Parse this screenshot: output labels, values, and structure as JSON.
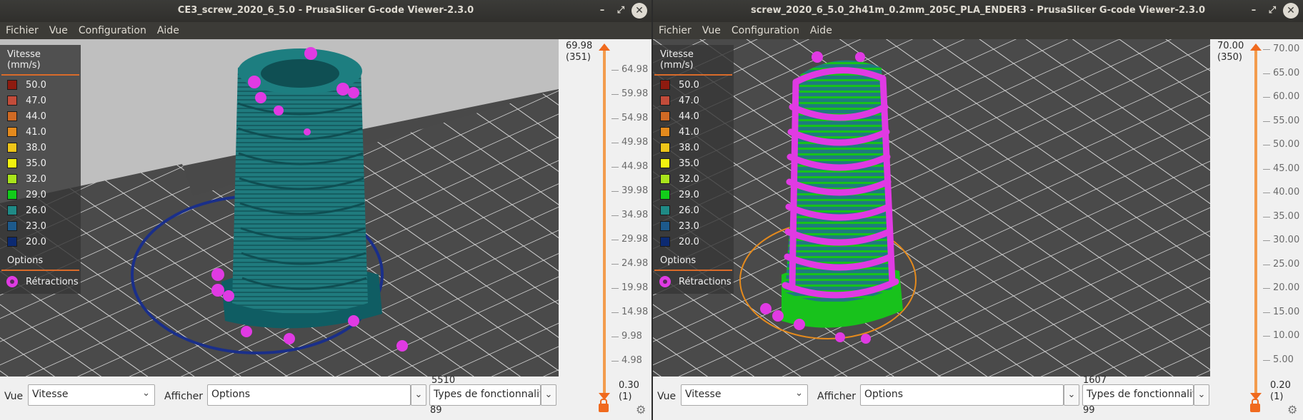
{
  "left": {
    "title": "CE3_screw_2020_6_5.0 - PrusaSlicer G-code Viewer-2.3.0",
    "menu": [
      "Fichier",
      "Vue",
      "Configuration",
      "Aide"
    ],
    "legend": {
      "title": "Vitesse (mm/s)",
      "items": [
        {
          "label": "50.0",
          "color": "#8e1b10"
        },
        {
          "label": "47.0",
          "color": "#c24c3a"
        },
        {
          "label": "44.0",
          "color": "#d06a24"
        },
        {
          "label": "41.0",
          "color": "#e48a1d"
        },
        {
          "label": "38.0",
          "color": "#eec519"
        },
        {
          "label": "35.0",
          "color": "#f2f20f"
        },
        {
          "label": "32.0",
          "color": "#a9e41c"
        },
        {
          "label": "29.0",
          "color": "#12cc1a"
        },
        {
          "label": "26.0",
          "color": "#1f8a86"
        },
        {
          "label": "23.0",
          "color": "#1d5a8c"
        },
        {
          "label": "20.0",
          "color": "#0c2a72"
        }
      ],
      "options_title": "Options",
      "retractions": "Rétractions"
    },
    "slider": {
      "top_value": "69.98",
      "top_layer": "(351)",
      "bottom_value": "0.30",
      "bottom_layer": "(1)",
      "ticks": [
        "64.98",
        "59.98",
        "54.98",
        "49.98",
        "44.98",
        "39.98",
        "34.98",
        "29.98",
        "24.98",
        "19.98",
        "14.98",
        "9.98",
        "4.98"
      ]
    },
    "bottom": {
      "vue_label": "Vue",
      "vue_value": "Vitesse",
      "afficher_label": "Afficher",
      "afficher_value": "Options",
      "hslider_top": "5510",
      "hslider_bottom": "89",
      "types_value": "Types de fonctionnalit"
    }
  },
  "right": {
    "title": "screw_2020_6_5.0_2h41m_0.2mm_205C_PLA_ENDER3 - PrusaSlicer G-code Viewer-2.3.0",
    "menu": [
      "Fichier",
      "Vue",
      "Configuration",
      "Aide"
    ],
    "legend": {
      "title": "Vitesse (mm/s)",
      "items": [
        {
          "label": "50.0",
          "color": "#8e1b10"
        },
        {
          "label": "47.0",
          "color": "#c24c3a"
        },
        {
          "label": "44.0",
          "color": "#d06a24"
        },
        {
          "label": "41.0",
          "color": "#e48a1d"
        },
        {
          "label": "38.0",
          "color": "#eec519"
        },
        {
          "label": "35.0",
          "color": "#f2f20f"
        },
        {
          "label": "32.0",
          "color": "#a9e41c"
        },
        {
          "label": "29.0",
          "color": "#12cc1a"
        },
        {
          "label": "26.0",
          "color": "#1f8a86"
        },
        {
          "label": "23.0",
          "color": "#1d5a8c"
        },
        {
          "label": "20.0",
          "color": "#0c2a72"
        }
      ],
      "options_title": "Options",
      "retractions": "Rétractions"
    },
    "slider": {
      "top_value": "70.00",
      "top_layer": "(350)",
      "bottom_value": "0.20",
      "bottom_layer": "(1)",
      "ticks": [
        "70.00",
        "65.00",
        "60.00",
        "55.00",
        "50.00",
        "45.00",
        "40.00",
        "35.00",
        "30.00",
        "25.00",
        "20.00",
        "15.00",
        "10.00",
        "5.00"
      ]
    },
    "bottom": {
      "vue_label": "Vue",
      "vue_value": "Vitesse",
      "afficher_label": "Afficher",
      "afficher_value": "Options",
      "hslider_top": "1607",
      "hslider_bottom": "99",
      "types_value": "Types de fonctionnalit"
    }
  },
  "colors": {
    "retraction": "#e03ae3",
    "accent": "#f06a1e"
  }
}
